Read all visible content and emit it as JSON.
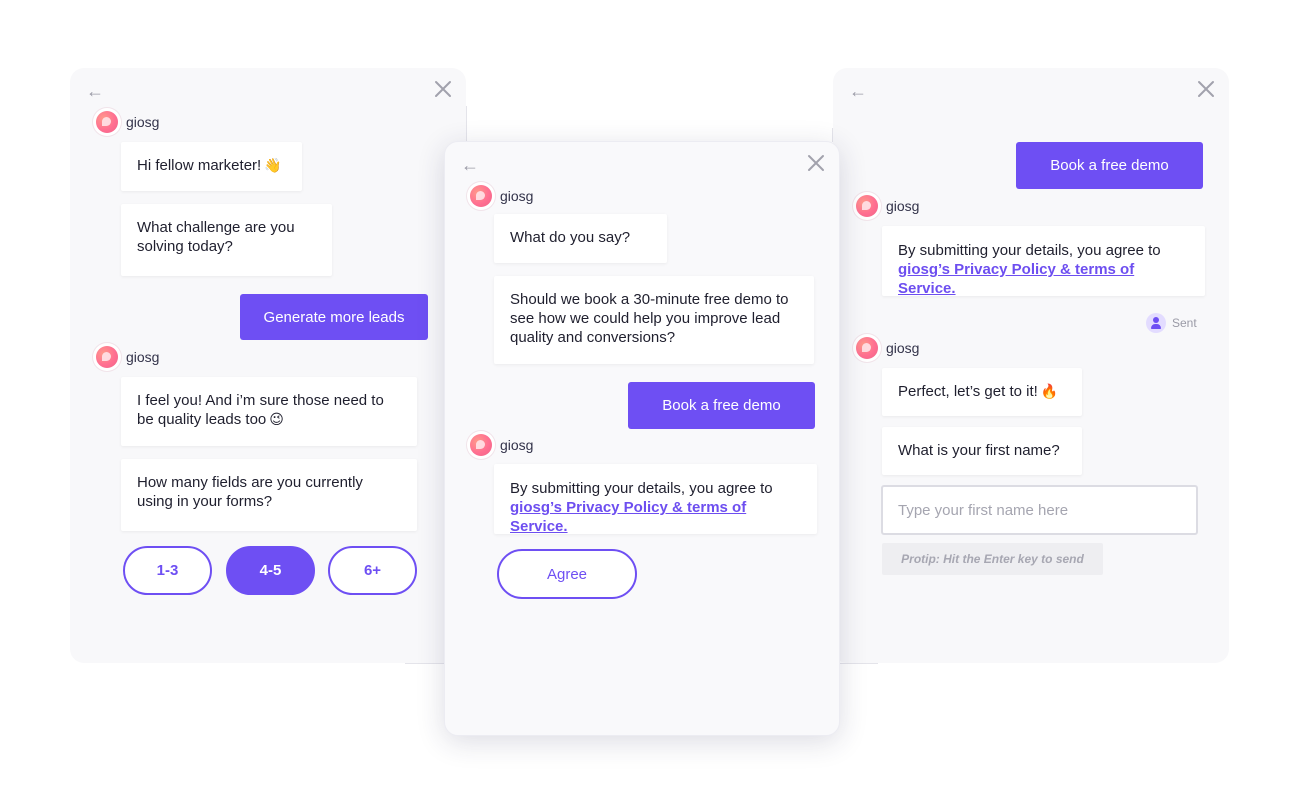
{
  "brand": {
    "name": "giosg",
    "accent": "#6e4ff3"
  },
  "icons": {
    "back": "arrow-left-icon",
    "close": "close-icon",
    "avatar": "giosg-logo-icon",
    "user": "user-icon"
  },
  "left": {
    "sender1": "giosg",
    "msg1": "Hi fellow marketer!",
    "msg1_emoji": "👋",
    "msg2": "What challenge are you solving today?",
    "reply": "Generate more leads",
    "sender2": "giosg",
    "msg3": "I feel you! And i’m sure those need to be quality leads too",
    "msg3_emoji": "😉",
    "msg4": "How many fields are you currently using in your forms?",
    "options": [
      "1-3",
      "4-5",
      "6+"
    ],
    "selected_option": "4-5"
  },
  "center": {
    "sender1": "giosg",
    "msg1": "What do you say?",
    "msg2": "Should we book a 30-minute free demo to see how we could help you improve lead quality and conversions?",
    "reply": "Book a free demo",
    "sender2": "giosg",
    "consent_text": "By submitting your details, you agree to",
    "consent_link": "giosg’s Privacy Policy & terms of Service.",
    "agree": "Agree"
  },
  "right": {
    "reply": "Book a free demo",
    "sender1": "giosg",
    "consent_text": "By submitting your details, you agree to",
    "consent_link": "giosg’s Privacy Policy & terms of Service.",
    "sent_status": "Sent",
    "sender2": "giosg",
    "msg1": "Perfect, let’s get to it!",
    "msg1_emoji": "🔥",
    "msg2": "What is your first name?",
    "input_placeholder": "Type your first name here",
    "protip": "Protip: Hit the Enter key to send"
  }
}
